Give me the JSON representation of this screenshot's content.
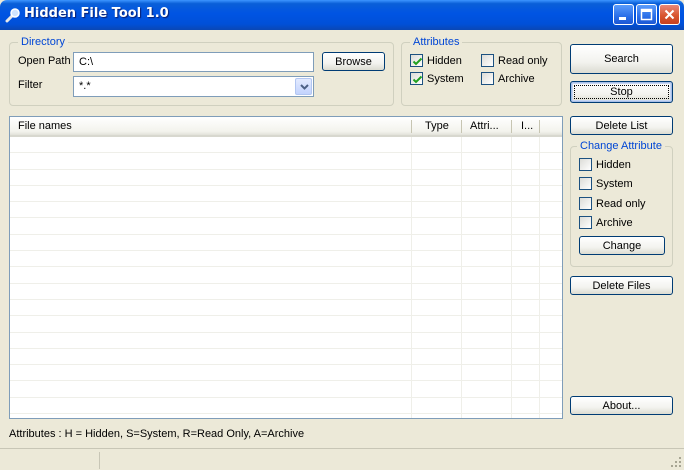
{
  "window": {
    "title": "Hidden File Tool 1.0",
    "icon": "magnifier-icon",
    "controls": [
      "minimize-icon",
      "maximize-icon",
      "close-icon"
    ]
  },
  "directory": {
    "legend": "Directory",
    "open_path_label": "Open Path",
    "open_path_value": "C:\\",
    "browse_label": "Browse",
    "filter_label": "Filter",
    "filter_value": "*.*"
  },
  "attributes": {
    "legend": "Attributes",
    "hidden": {
      "label": "Hidden",
      "checked": true
    },
    "system": {
      "label": "System",
      "checked": true
    },
    "read_only": {
      "label": "Read only",
      "checked": false
    },
    "archive": {
      "label": "Archive",
      "checked": false
    }
  },
  "actions": {
    "search_label": "Search",
    "stop_label": "Stop",
    "delete_list_label": "Delete List",
    "delete_files_label": "Delete Files",
    "about_label": "About..."
  },
  "change_attribute": {
    "legend": "Change Attribute",
    "hidden": {
      "label": "Hidden",
      "checked": false
    },
    "system": {
      "label": "System",
      "checked": false
    },
    "read_only": {
      "label": "Read only",
      "checked": false
    },
    "archive": {
      "label": "Archive",
      "checked": false
    },
    "change_label": "Change"
  },
  "file_list": {
    "columns": [
      "File names",
      "Type",
      "Attri...",
      "I..."
    ],
    "rows": []
  },
  "footer": {
    "legend_text": "Attributes : H = Hidden, S=System, R=Read Only, A=Archive"
  },
  "colors": {
    "titlebar": "#0054e3",
    "legend_text": "#0046d5",
    "window_bg": "#ece9d8",
    "close_button": "#d9552f"
  }
}
